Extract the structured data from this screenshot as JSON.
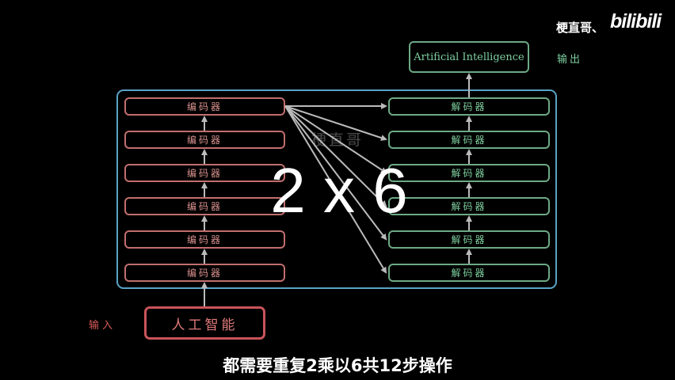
{
  "header": {
    "channel_name": "梗直哥、",
    "site_logo": "bilibili"
  },
  "diagram": {
    "encoder_label": "编码器",
    "decoder_label": "解码器",
    "output_text": "Artificial Intelligence",
    "output_label": "输出",
    "input_text": "人工智能",
    "input_label": "输入",
    "watermark": "梗直哥",
    "multiplier": "2 x 6"
  },
  "subtitle": "都需要重复2乘以6共12步操作",
  "colors": {
    "encoder": "#c26e6e",
    "decoder": "#6da985",
    "frame": "#5aa3c7",
    "input": "#c9545a",
    "arrow": "#bbbbbb"
  }
}
